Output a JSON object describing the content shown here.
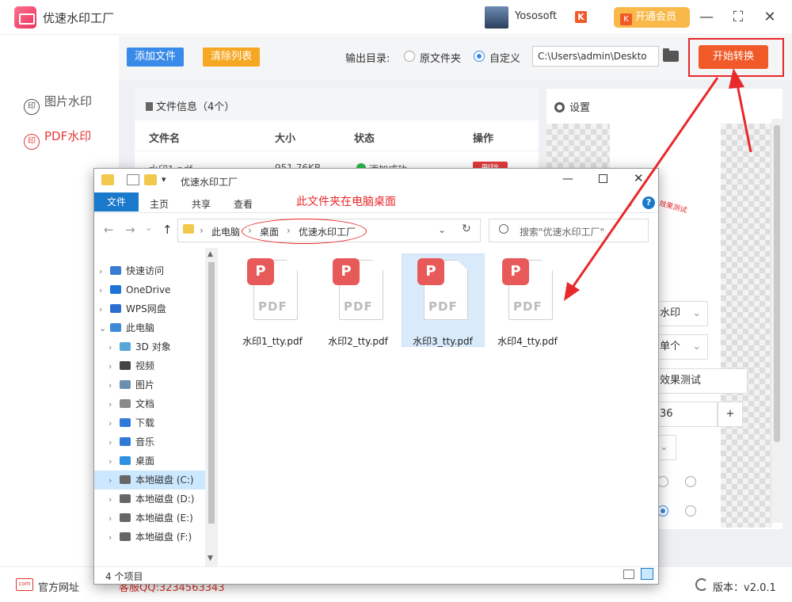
{
  "app": {
    "title": "优速水印工厂"
  },
  "user": {
    "name": "Yososoft",
    "badge": "K",
    "vip_label": "开通会员"
  },
  "window_controls": {
    "minimize": "—",
    "maximize": "⛶",
    "close": "✕"
  },
  "sidebar": {
    "items": [
      {
        "label": "图片水印",
        "icon": "印",
        "active": false
      },
      {
        "label": "PDF水印",
        "icon": "印",
        "active": true
      }
    ]
  },
  "toolbar": {
    "add_file": "添加文件",
    "clear_list": "清除列表",
    "output_label": "输出目录:",
    "option_source": "原文件夹",
    "option_custom": "自定义",
    "path_value": "C:\\Users\\admin\\Deskto",
    "start_button": "开始转换"
  },
  "file_panel": {
    "title": "文件信息（4个）",
    "columns": [
      "文件名",
      "大小",
      "状态",
      "操作"
    ],
    "row_visible": {
      "name": "水印1.pdf",
      "size": "951.76KB",
      "status": "添加成功",
      "action": "删除"
    }
  },
  "settings": {
    "title": "设置",
    "watermark_type": "水印",
    "count_option": "单个",
    "test_button": "效果测试",
    "font_size": "36",
    "plus": "+",
    "preview_stamp": "效果测试"
  },
  "footer": {
    "site_icon": "com",
    "site_link": "官方网址",
    "qq": "客服QQ:3234563343",
    "version": "版本：v2.0.1"
  },
  "explorer": {
    "title": "优速水印工厂",
    "menu": {
      "file": "文件",
      "home": "主页",
      "share": "共享",
      "view": "查看"
    },
    "annotation": "此文件夹在电脑桌面",
    "breadcrumb": [
      "此电脑",
      "桌面",
      "优速水印工厂"
    ],
    "search_placeholder": "搜索\"优速水印工厂\"",
    "nav_items": [
      {
        "label": "快速访问",
        "icon": "star-icon",
        "color": "#3a7bd5",
        "indent": 0,
        "chev": "›"
      },
      {
        "label": "OneDrive",
        "icon": "cloud-icon",
        "color": "#1e73d6",
        "indent": 0,
        "chev": "›"
      },
      {
        "label": "WPS网盘",
        "icon": "cloud-icon",
        "color": "#2d6fd0",
        "indent": 0,
        "chev": "›"
      },
      {
        "label": "此电脑",
        "icon": "computer-icon",
        "color": "#3d8ad6",
        "indent": 0,
        "chev": "⌄"
      },
      {
        "label": "3D 对象",
        "icon": "cube-icon",
        "color": "#58a5d8",
        "indent": 1,
        "chev": "›"
      },
      {
        "label": "视频",
        "icon": "film-icon",
        "color": "#444444",
        "indent": 1,
        "chev": "›"
      },
      {
        "label": "图片",
        "icon": "picture-icon",
        "color": "#6a8fb0",
        "indent": 1,
        "chev": "›"
      },
      {
        "label": "文档",
        "icon": "document-icon",
        "color": "#8a8a8a",
        "indent": 1,
        "chev": "›"
      },
      {
        "label": "下载",
        "icon": "download-icon",
        "color": "#2f7ad6",
        "indent": 1,
        "chev": "›"
      },
      {
        "label": "音乐",
        "icon": "music-icon",
        "color": "#2f7ad6",
        "indent": 1,
        "chev": "›"
      },
      {
        "label": "桌面",
        "icon": "desktop-icon",
        "color": "#2f8fe0",
        "indent": 1,
        "chev": "›"
      },
      {
        "label": "本地磁盘 (C:)",
        "icon": "drive-icon",
        "color": "#666666",
        "indent": 1,
        "chev": "›"
      },
      {
        "label": "本地磁盘 (D:)",
        "icon": "drive-icon",
        "color": "#666666",
        "indent": 1,
        "chev": "›"
      },
      {
        "label": "本地磁盘 (E:)",
        "icon": "drive-icon",
        "color": "#666666",
        "indent": 1,
        "chev": "›"
      },
      {
        "label": "本地磁盘 (F:)",
        "icon": "drive-icon",
        "color": "#666666",
        "indent": 1,
        "chev": "›"
      }
    ],
    "files": [
      {
        "name": "水印1_tty.pdf",
        "type": "PDF",
        "badge": "P"
      },
      {
        "name": "水印2_tty.pdf",
        "type": "PDF",
        "badge": "P"
      },
      {
        "name": "水印3_tty.pdf",
        "type": "PDF",
        "badge": "P"
      },
      {
        "name": "水印4_tty.pdf",
        "type": "PDF",
        "badge": "P"
      }
    ],
    "status": "4 个项目"
  },
  "colors": {
    "accent": "#f05a28",
    "blue": "#3a8be9",
    "orange": "#f7a823",
    "highlight": "#e8282b"
  }
}
